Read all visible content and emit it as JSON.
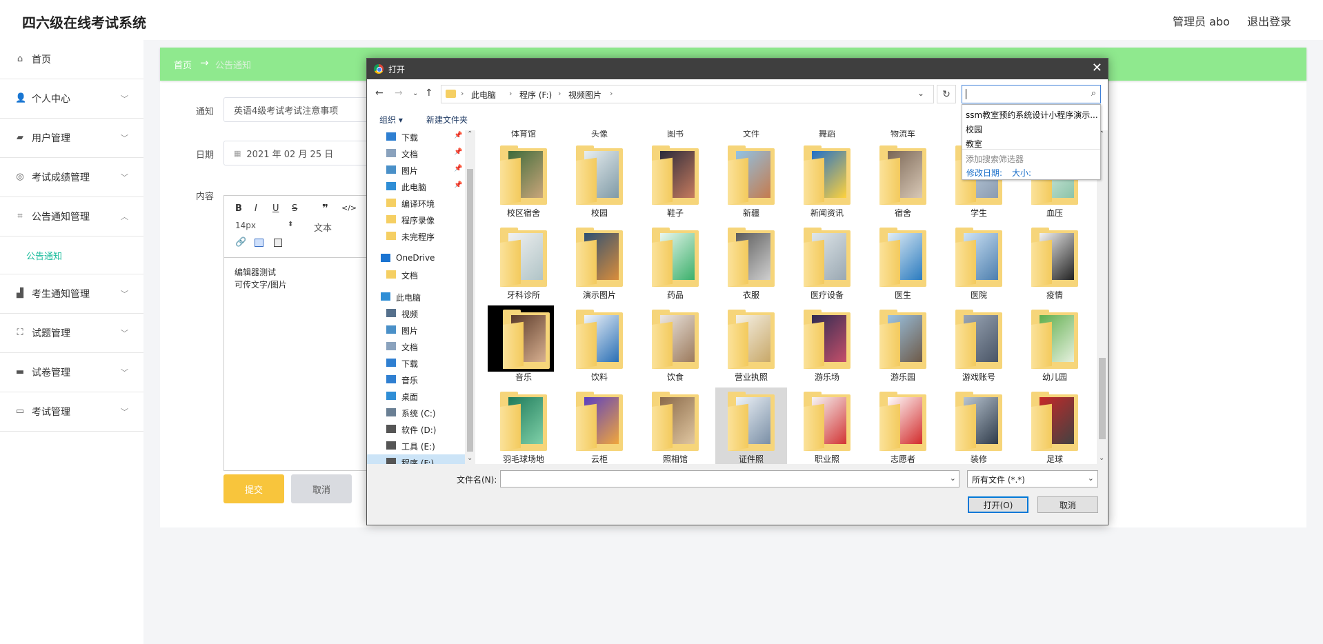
{
  "app": {
    "title": "四六级在线考试系统",
    "admin": "管理员 abo",
    "logout": "退出登录"
  },
  "sidebar": {
    "items": [
      {
        "label": "首页",
        "icon": "home-icon",
        "glyph": "⌂",
        "chevron": ""
      },
      {
        "label": "个人中心",
        "icon": "user-icon",
        "glyph": "👤",
        "chevron": "﹀"
      },
      {
        "label": "用户管理",
        "icon": "user-manage-icon",
        "glyph": "▰",
        "chevron": "﹀"
      },
      {
        "label": "考试成绩管理",
        "icon": "compass-icon",
        "glyph": "◎",
        "chevron": "﹀"
      },
      {
        "label": "公告通知管理",
        "icon": "crop-icon",
        "glyph": "⌗",
        "chevron": "︿"
      },
      {
        "label": "公告通知",
        "sub": true
      },
      {
        "label": "考生通知管理",
        "icon": "chart-icon",
        "glyph": "▟",
        "chevron": "﹀"
      },
      {
        "label": "试题管理",
        "icon": "fullscreen-icon",
        "glyph": "⛶",
        "chevron": "﹀"
      },
      {
        "label": "试卷管理",
        "icon": "monitor-icon",
        "glyph": "▬",
        "chevron": "﹀"
      },
      {
        "label": "考试管理",
        "icon": "desktop-icon",
        "glyph": "▭",
        "chevron": "﹀"
      }
    ]
  },
  "breadcrumb": {
    "home": "首页",
    "arrow": "→",
    "current": "公告通知"
  },
  "form": {
    "notice_label": "通知",
    "notice_value": "英语4级考试考试注意事项",
    "date_label": "日期",
    "date_value": "2021 年 02 月 25 日",
    "content_label": "内容",
    "font_size": "14px",
    "text_style": "文本",
    "content_line1": "编辑器测试",
    "content_line2": "可传文字/图片",
    "submit": "提交",
    "cancel": "取消"
  },
  "dialog": {
    "title": "打开",
    "path": [
      "此电脑",
      "程序 (F:)",
      "视频图片"
    ],
    "organize": "组织 ▾",
    "new_folder": "新建文件夹",
    "search_value": "",
    "suggestions": [
      "ssm教室预约系统设计小程序演示...",
      "校园",
      "教室"
    ],
    "filter_header": "添加搜索筛选器",
    "filter_links": [
      "修改日期:",
      "大小:"
    ],
    "nav": [
      {
        "label": "下载",
        "icon": "download-icon",
        "color": "#2f7fd1",
        "pin": true
      },
      {
        "label": "文档",
        "icon": "document-icon",
        "color": "#8aa2bd",
        "pin": true
      },
      {
        "label": "图片",
        "icon": "picture-icon",
        "color": "#4a90c8",
        "pin": true
      },
      {
        "label": "此电脑",
        "icon": "computer-icon",
        "color": "#2f8ed6",
        "pin": true
      },
      {
        "label": "编译环境",
        "icon": "folder-icon",
        "color": "#f5cf63",
        "pin": false
      },
      {
        "label": "程序录像",
        "icon": "folder-icon",
        "color": "#f5cf63",
        "pin": false
      },
      {
        "label": "未完程序",
        "icon": "folder-icon",
        "color": "#f5cf63",
        "pin": false
      },
      {
        "label": "OneDrive",
        "icon": "cloud-icon",
        "color": "#1b74d1",
        "pin": false
      },
      {
        "label": "文档",
        "icon": "folder-icon",
        "color": "#f5cf63",
        "pin": false
      },
      {
        "label": "此电脑",
        "icon": "computer-icon",
        "color": "#2f8ed6",
        "pin": false
      },
      {
        "label": "视频",
        "icon": "video-icon",
        "color": "#55708c",
        "pin": false
      },
      {
        "label": "图片",
        "icon": "picture-icon",
        "color": "#4a90c8",
        "pin": false
      },
      {
        "label": "文档",
        "icon": "document-icon",
        "color": "#8aa2bd",
        "pin": false
      },
      {
        "label": "下载",
        "icon": "download-icon",
        "color": "#2f7fd1",
        "pin": false
      },
      {
        "label": "音乐",
        "icon": "music-icon",
        "color": "#2f7fd1",
        "pin": false
      },
      {
        "label": "桌面",
        "icon": "desktop-icon",
        "color": "#2f8ed6",
        "pin": false
      },
      {
        "label": "系统 (C:)",
        "icon": "drive-icon",
        "color": "#6a7f94",
        "pin": false
      },
      {
        "label": "软件 (D:)",
        "icon": "drive-icon",
        "color": "#555",
        "pin": false
      },
      {
        "label": "工具 (E:)",
        "icon": "drive-icon",
        "color": "#555",
        "pin": false
      },
      {
        "label": "程序 (F:)",
        "icon": "drive-icon",
        "color": "#555",
        "pin": false,
        "selected": true
      }
    ],
    "top_labels": [
      "体育馆",
      "头像",
      "图书",
      "文件",
      "舞蹈",
      "物流车"
    ],
    "folders": [
      {
        "name": "校区宿舍",
        "c1": "#3d6b3a",
        "c2": "#c9a57a"
      },
      {
        "name": "校园",
        "c1": "#e8eef0",
        "c2": "#7f9aa6"
      },
      {
        "name": "鞋子",
        "c1": "#2a2a3a",
        "c2": "#c77b5e"
      },
      {
        "name": "新疆",
        "c1": "#8fc3e6",
        "c2": "#c57b4d"
      },
      {
        "name": "新闻资讯",
        "c1": "#1f6fc9",
        "c2": "#ffd23c"
      },
      {
        "name": "宿舍",
        "c1": "#7a6655",
        "c2": "#d8c8b6"
      },
      {
        "name": "学生",
        "c1": "#c9d9e8",
        "c2": "#8a9bb0"
      },
      {
        "name": "血压",
        "c1": "#e9f6f1",
        "c2": "#8bc3a8"
      },
      {
        "name": "牙科诊所",
        "c1": "#f1f1f1",
        "c2": "#b0c4c7"
      },
      {
        "name": "演示图片",
        "c1": "#2d4f73",
        "c2": "#d98d3b"
      },
      {
        "name": "药品",
        "c1": "#eaf7ef",
        "c2": "#3bb06b"
      },
      {
        "name": "衣服",
        "c1": "#5b5b5b",
        "c2": "#cfcfcf"
      },
      {
        "name": "医疗设备",
        "c1": "#dfe6ea",
        "c2": "#9aa8b2"
      },
      {
        "name": "医生",
        "c1": "#e2eef6",
        "c2": "#2b7bbf"
      },
      {
        "name": "医院",
        "c1": "#cfe3f5",
        "c2": "#4d7fae"
      },
      {
        "name": "疫情",
        "c1": "#f2f2f2",
        "c2": "#222"
      },
      {
        "name": "音乐",
        "c1": "#5a3a2a",
        "c2": "#d8b090",
        "dark": true
      },
      {
        "name": "饮料",
        "c1": "#f3f6fa",
        "c2": "#2a6fb5"
      },
      {
        "name": "饮食",
        "c1": "#ece7e2",
        "c2": "#9c7a5c"
      },
      {
        "name": "营业执照",
        "c1": "#f6f2e8",
        "c2": "#c8a868"
      },
      {
        "name": "游乐场",
        "c1": "#2e2b52",
        "c2": "#c54f6a"
      },
      {
        "name": "游乐园",
        "c1": "#9ac3e3",
        "c2": "#6e5a48"
      },
      {
        "name": "游戏账号",
        "c1": "#9aa6b5",
        "c2": "#4a5566"
      },
      {
        "name": "幼儿园",
        "c1": "#5fae4c",
        "c2": "#e5f0de"
      },
      {
        "name": "羽毛球场地",
        "c1": "#1e7a5a",
        "c2": "#7fd0a8"
      },
      {
        "name": "云柜",
        "c1": "#5a3fc2",
        "c2": "#f0a63c"
      },
      {
        "name": "照相馆",
        "c1": "#8a6a4a",
        "c2": "#e0c6a0"
      },
      {
        "name": "证件照",
        "c1": "#eef3f8",
        "c2": "#7a8fa6",
        "selected": true
      },
      {
        "name": "职业照",
        "c1": "#f6f6f6",
        "c2": "#d23434"
      },
      {
        "name": "志愿者",
        "c1": "#ffffff",
        "c2": "#d22b2b"
      },
      {
        "name": "装修",
        "c1": "#b8c4d0",
        "c2": "#2f3b4a"
      },
      {
        "name": "足球",
        "c1": "#c62828",
        "c2": "#424242"
      }
    ],
    "filename_label": "文件名(N):",
    "filename_value": "",
    "filetype": "所有文件 (*.*)",
    "open": "打开(O)",
    "cancel": "取消"
  }
}
